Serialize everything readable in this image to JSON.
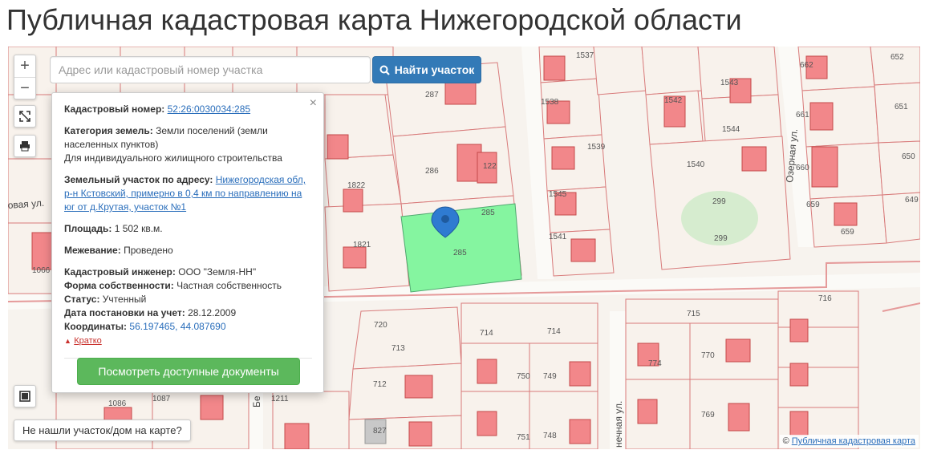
{
  "page_title": "Публичная кадастровая карта Нижегородской области",
  "search": {
    "placeholder": "Адрес или кадастровый номер участка",
    "value": "",
    "button_label": "Найти участок"
  },
  "controls": {
    "zoom_in": "+",
    "zoom_out": "−"
  },
  "popup": {
    "close_label": "×",
    "cadastral_number_label": "Кадастровый номер:",
    "cadastral_number": "52:26:0030034:285",
    "land_category_label": "Категория земель:",
    "land_category": "Земли поселений (земли населенных пунктов)",
    "land_use": "Для индивидуального жилищного строительства",
    "address_label": "Земельный участок по адресу:",
    "address": "Нижегородская обл, р-н Кстовский, примерно в 0,4 км по направлению на юг от д.Крутая, участок №1",
    "area_label": "Площадь:",
    "area": "1 502 кв.м.",
    "survey_label": "Межевание:",
    "survey": "Проведено",
    "engineer_label": "Кадастровый инженер:",
    "engineer": "ООО \"Земля-НН\"",
    "ownership_label": "Форма собственности:",
    "ownership": "Частная собственность",
    "status_label": "Статус:",
    "status": "Учтенный",
    "registration_date_label": "Дата постановки на учет:",
    "registration_date": "28.12.2009",
    "coordinates_label": "Координаты:",
    "coordinates": "56.197465, 44.087690",
    "brief_link": "Кратко",
    "docs_button": "Посмотреть доступные документы"
  },
  "not_found_button": "Не нашли участок/дом на карте?",
  "attribution": {
    "prefix": "©",
    "link_text": "Публичная кадастровая карта"
  },
  "map": {
    "selected_parcel_color": "#85f5a0",
    "marker_color": "#2f7bd1",
    "street_labels": [
      "овая ул.",
      "Озерная ул.",
      "нечная ул.",
      "Бе"
    ],
    "parcel_labels": [
      "1537",
      "1542",
      "1543",
      "1538",
      "1539",
      "1540",
      "1541",
      "1544",
      "1545",
      "287",
      "286",
      "285",
      "122",
      "299",
      "713",
      "714",
      "715",
      "716",
      "720",
      "712",
      "749",
      "750",
      "748",
      "751",
      "770",
      "769",
      "774",
      "827",
      "1086",
      "1087",
      "1066",
      "1821",
      "1822",
      "651",
      "650",
      "649",
      "652",
      "659",
      "660",
      "661",
      "662",
      "906",
      "1211"
    ]
  }
}
